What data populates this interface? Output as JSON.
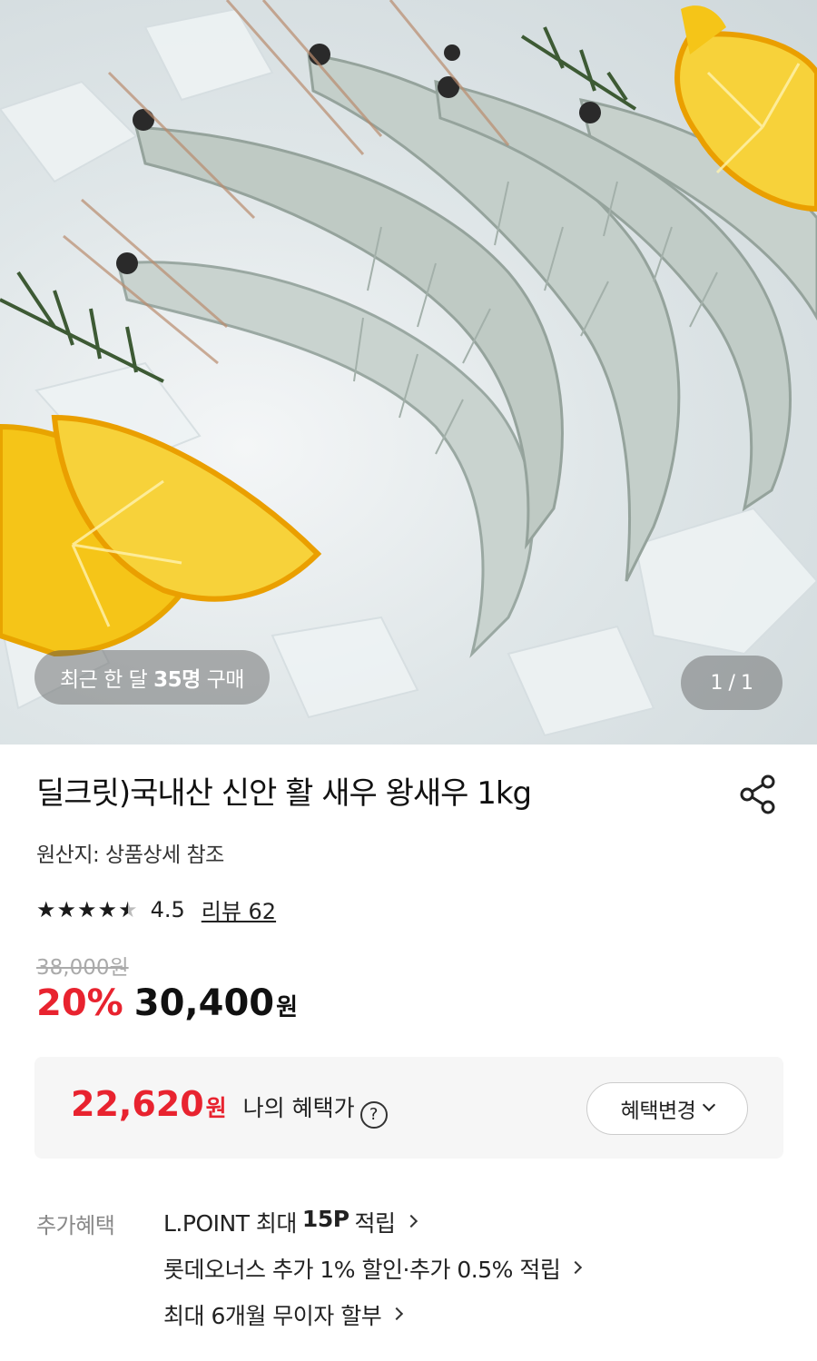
{
  "hero": {
    "buyers_prefix": "최근 한 달",
    "buyers_count": "35명",
    "buyers_suffix": "구매",
    "image_counter": "1 / 1"
  },
  "product": {
    "title": "딜크릿)국내산 신안 활 새우 왕새우 1kg",
    "origin": "원산지: 상품상세 참조",
    "rating": 4.5,
    "rating_text": "4.5",
    "review_link": "리뷰 62",
    "original_price": "38,000원",
    "discount": "20%",
    "price": "30,400",
    "price_unit": "원"
  },
  "benefit": {
    "my_price": "22,620",
    "my_price_unit": "원",
    "my_price_label": "나의 혜택가",
    "help_icon": "?",
    "change_button": "혜택변경"
  },
  "extra": {
    "label": "추가혜택",
    "items": [
      {
        "pre": "L.POINT 최대",
        "bold": "15P",
        "post": "적립"
      },
      {
        "pre": "롯데오너스 추가 1% 할인·추가 0.5% 적립",
        "bold": "",
        "post": ""
      },
      {
        "pre": "최대 6개월 무이자 할부",
        "bold": "",
        "post": ""
      }
    ]
  },
  "icons": {
    "share": "share-icon",
    "star": "star-icon",
    "chevron": "chevron-right-icon"
  },
  "colors": {
    "accent_red": "#e8232f",
    "strike_gray": "#aaaaaa",
    "box_bg": "#f6f6f6"
  }
}
